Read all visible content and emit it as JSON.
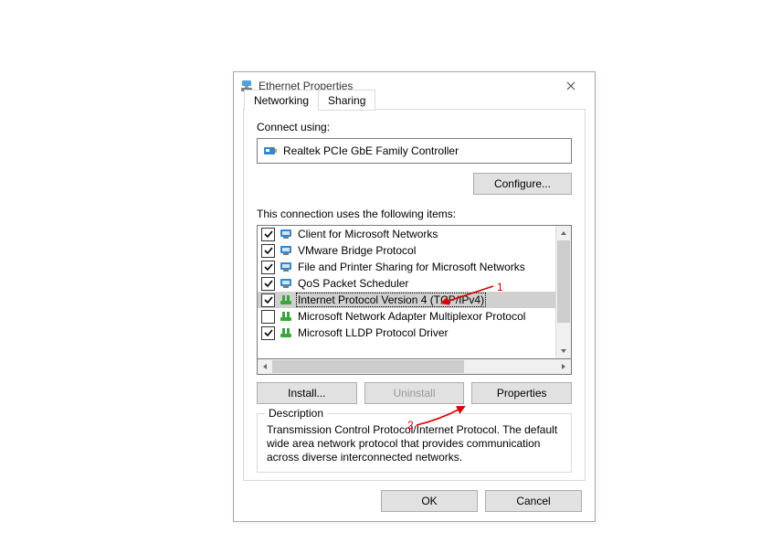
{
  "dialog": {
    "title": "Ethernet Properties",
    "tabs": [
      {
        "label": "Networking",
        "active": true
      },
      {
        "label": "Sharing",
        "active": false
      }
    ],
    "connect_using_label": "Connect using:",
    "adapter": "Realtek PCIe GbE Family Controller",
    "configure_label": "Configure...",
    "items_label": "This connection uses the following items:",
    "items": [
      {
        "checked": true,
        "icon": "client",
        "label": "Client for Microsoft Networks",
        "selected": false
      },
      {
        "checked": true,
        "icon": "client",
        "label": "VMware Bridge Protocol",
        "selected": false
      },
      {
        "checked": true,
        "icon": "client",
        "label": "File and Printer Sharing for Microsoft Networks",
        "selected": false
      },
      {
        "checked": true,
        "icon": "client",
        "label": "QoS Packet Scheduler",
        "selected": false
      },
      {
        "checked": true,
        "icon": "protocol",
        "label": "Internet Protocol Version 4 (TCP/IPv4)",
        "selected": true
      },
      {
        "checked": false,
        "icon": "protocol",
        "label": "Microsoft Network Adapter Multiplexor Protocol",
        "selected": false
      },
      {
        "checked": true,
        "icon": "protocol",
        "label": "Microsoft LLDP Protocol Driver",
        "selected": false
      }
    ],
    "install_label": "Install...",
    "uninstall_label": "Uninstall",
    "properties_label": "Properties",
    "description_legend": "Description",
    "description_text": "Transmission Control Protocol/Internet Protocol. The default wide area network protocol that provides communication across diverse interconnected networks.",
    "ok_label": "OK",
    "cancel_label": "Cancel"
  },
  "annotations": {
    "one": "1",
    "two": "2"
  }
}
